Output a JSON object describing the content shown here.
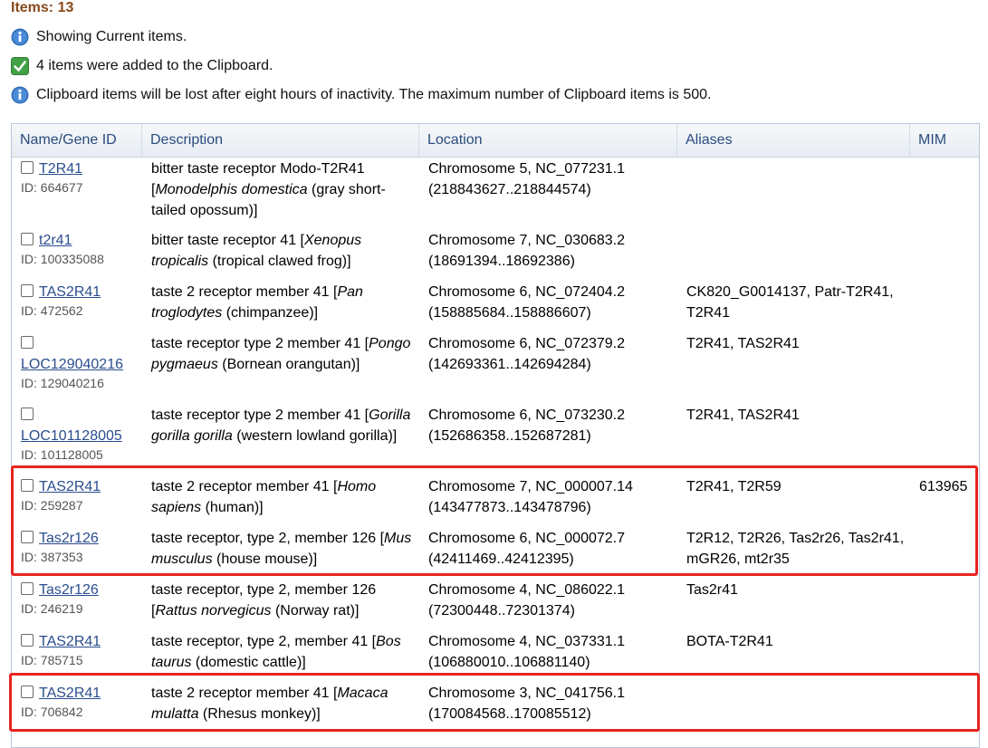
{
  "header": {
    "items_count": "Items: 13"
  },
  "messages": [
    {
      "icon": "info-icon",
      "text": "Showing Current items."
    },
    {
      "icon": "checkmark-icon",
      "text": "4 items were added to the Clipboard."
    },
    {
      "icon": "info-icon",
      "text": "Clipboard items will be lost after eight hours of inactivity. The maximum number of Clipboard items is 500."
    }
  ],
  "table": {
    "columns": [
      "Name/Gene ID",
      "Description",
      "Location",
      "Aliases",
      "MIM"
    ],
    "rows": [
      {
        "name": "T2R41",
        "id": "ID: 664677",
        "desc_pre": "bitter taste receptor Modo-T2R41 [",
        "desc_species": "Monodelphis domestica",
        "desc_post": " (gray short-tailed opossum)]",
        "loc1": "Chromosome 5, NC_077231.1",
        "loc2": "(218843627..218844574)",
        "aliases": "",
        "mim": ""
      },
      {
        "name": "t2r41",
        "id": "ID: 100335088",
        "desc_pre": "bitter taste receptor 41 [",
        "desc_species": "Xenopus tropicalis",
        "desc_post": " (tropical clawed frog)]",
        "loc1": "Chromosome 7, NC_030683.2",
        "loc2": "(18691394..18692386)",
        "aliases": "",
        "mim": ""
      },
      {
        "name": "TAS2R41",
        "id": "ID: 472562",
        "desc_pre": "taste 2 receptor member 41 [",
        "desc_species": "Pan troglodytes",
        "desc_post": " (chimpanzee)]",
        "loc1": "Chromosome 6, NC_072404.2",
        "loc2": "(158885684..158886607)",
        "aliases": "CK820_G0014137, Patr-T2R41, T2R41",
        "mim": ""
      },
      {
        "name": "LOC129040216",
        "id": "ID: 129040216",
        "desc_pre": "taste receptor type 2 member 41 [",
        "desc_species": "Pongo pygmaeus",
        "desc_post": " (Bornean orangutan)]",
        "loc1": "Chromosome 6, NC_072379.2",
        "loc2": "(142693361..142694284)",
        "aliases": "T2R41, TAS2R41",
        "mim": ""
      },
      {
        "name": "LOC101128005",
        "id": "ID: 101128005",
        "desc_pre": "taste receptor type 2 member 41 [",
        "desc_species": "Gorilla gorilla gorilla",
        "desc_post": " (western lowland gorilla)]",
        "loc1": "Chromosome 6, NC_073230.2",
        "loc2": "(152686358..152687281)",
        "aliases": "T2R41, TAS2R41",
        "mim": ""
      },
      {
        "name": "TAS2R41",
        "id": "ID: 259287",
        "desc_pre": "taste 2 receptor member 41 [",
        "desc_species": "Homo sapiens",
        "desc_post": " (human)]",
        "loc1": "Chromosome 7, NC_000007.14",
        "loc2": "(143477873..143478796)",
        "aliases": "T2R41, T2R59",
        "mim": "613965"
      },
      {
        "name": "Tas2r126",
        "id": "ID: 387353",
        "desc_pre": "taste receptor, type 2, member 126 [",
        "desc_species": "Mus musculus",
        "desc_post": " (house mouse)]",
        "loc1": "Chromosome 6, NC_000072.7",
        "loc2": "(42411469..42412395)",
        "aliases": "T2R12, T2R26, Tas2r26, Tas2r41, mGR26, mt2r35",
        "mim": ""
      },
      {
        "name": "Tas2r126",
        "id": "ID: 246219",
        "desc_pre": "taste receptor, type 2, member 126 [",
        "desc_species": "Rattus norvegicus",
        "desc_post": " (Norway rat)]",
        "loc1": "Chromosome 4, NC_086022.1",
        "loc2": "(72300448..72301374)",
        "aliases": "Tas2r41",
        "mim": ""
      },
      {
        "name": "TAS2R41",
        "id": "ID: 785715",
        "desc_pre": "taste receptor, type 2, member 41 [",
        "desc_species": "Bos taurus",
        "desc_post": " (domestic cattle)]",
        "loc1": "Chromosome 4, NC_037331.1",
        "loc2": "(106880010..106881140)",
        "aliases": "BOTA-T2R41",
        "mim": ""
      },
      {
        "name": "TAS2R41",
        "id": "ID: 706842",
        "desc_pre": "taste 2 receptor member 41 [",
        "desc_species": "Macaca mulatta",
        "desc_post": " (Rhesus monkey)]",
        "loc1": "Chromosome 3, NC_041756.1",
        "loc2": "(170084568..170085512)",
        "aliases": "",
        "mim": ""
      }
    ]
  },
  "colors": {
    "highlight_border": "#e8231f",
    "link": "#2a4d8e",
    "items_count": "#8a4a1b",
    "header_text": "#2b4c7e"
  }
}
